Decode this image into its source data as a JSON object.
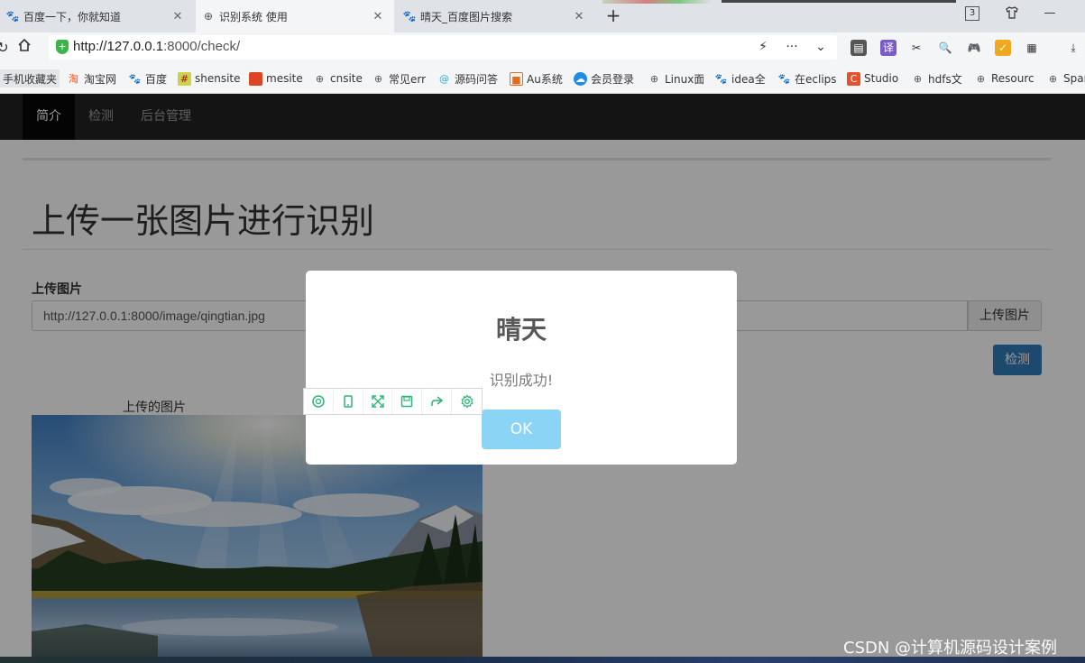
{
  "browser": {
    "tabs": [
      {
        "label": "百度一下，你就知道",
        "icon": "baidu-paw-icon",
        "active": false
      },
      {
        "label": "识别系统 使用",
        "icon": "globe-icon",
        "active": true
      },
      {
        "label": "晴天_百度图片搜索",
        "icon": "baidu-paw-icon",
        "active": false
      }
    ],
    "tab_count_badge": "3",
    "url_host": "http://127.0.0.1",
    "url_rest": ":8000/check/",
    "bookmarks": [
      {
        "label": "手机收藏夹",
        "icon": "none"
      },
      {
        "label": "淘宝网",
        "icon": "taobao-icon"
      },
      {
        "label": "百度",
        "icon": "baidu-paw-icon"
      },
      {
        "label": "shensite",
        "icon": "grid-icon"
      },
      {
        "label": "mesite",
        "icon": "red-square-icon"
      },
      {
        "label": "cnsite",
        "icon": "globe-icon"
      },
      {
        "label": "常见err",
        "icon": "globe-icon"
      },
      {
        "label": "源码问答",
        "icon": "swirl-icon"
      },
      {
        "label": "Au系统",
        "icon": "orange-box-icon"
      },
      {
        "label": "会员登录",
        "icon": "cloud-icon"
      },
      {
        "label": "Linux面",
        "icon": "globe-icon"
      },
      {
        "label": "idea全",
        "icon": "baidu-paw-icon"
      },
      {
        "label": "在eclips",
        "icon": "baidu-paw-icon"
      },
      {
        "label": "Studio",
        "icon": "c-icon"
      },
      {
        "label": "hdfs文",
        "icon": "globe-icon"
      },
      {
        "label": "Resourc",
        "icon": "globe-icon"
      },
      {
        "label": "Spar",
        "icon": "globe-icon"
      }
    ]
  },
  "nav": {
    "items": [
      {
        "label": "简介",
        "active": true
      },
      {
        "label": "检测",
        "active": false
      },
      {
        "label": "后台管理",
        "active": false
      }
    ]
  },
  "main": {
    "heading": "上传一张图片进行识别",
    "upload_label": "上传图片",
    "upload_value": "http://127.0.0.1:8000/image/qingtian.jpg",
    "upload_button": "上传图片",
    "detect_button": "检测",
    "image_caption": "上传的图片"
  },
  "modal": {
    "title": "晴天",
    "text": "识别成功!",
    "ok": "OK"
  },
  "colors": {
    "primary": "#337ab7",
    "ok_button": "#8cd4f5",
    "navbar": "#222222",
    "shot_tool": "#2bb673"
  },
  "watermark": "CSDN @计算机源码设计案例"
}
